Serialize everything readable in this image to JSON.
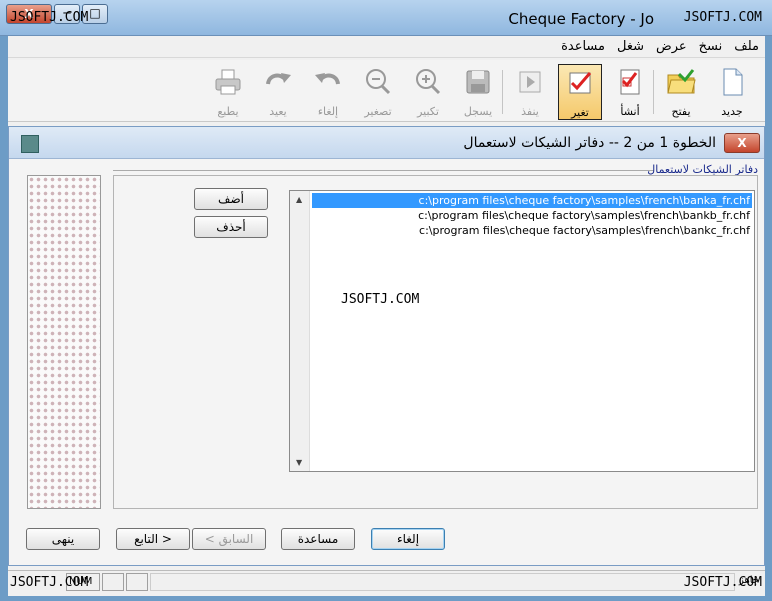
{
  "window": {
    "title": "Cheque Factory - Jo",
    "watermark": "JSOFTJ.COM",
    "close_glyph": "X",
    "min_glyph": "─",
    "max_glyph": "□"
  },
  "menu": [
    "ملف",
    "نسخ",
    "عرض",
    "شغل",
    "مساعدة"
  ],
  "toolbar": {
    "new": "جديد",
    "open": "يفتح",
    "create": "أنشأ",
    "change": "تغير",
    "execute": "ينفذ",
    "save": "يسجل",
    "zoom_in": "تكبير",
    "zoom_out": "تصغير",
    "undo": "إلغاء",
    "redo": "يعيد",
    "print": "يطبع"
  },
  "wizard": {
    "title": "الخطوة 1 من 2 -- دفاتر الشيكات لاستعمال",
    "close_glyph": "X",
    "group_caption": "دفاتر الشيكات لاستعمال",
    "add_button": "أضف",
    "remove_button": "أحذف",
    "files": [
      "c:\\program files\\cheque factory\\samples\\french\\banka_fr.chf",
      "c:\\program files\\cheque factory\\samples\\french\\bankb_fr.chf",
      "c:\\program files\\cheque factory\\samples\\french\\bankc_fr.chf"
    ],
    "selected_index": 0,
    "finish_button": "ينهى",
    "next_button": "التابع >",
    "back_button": "< السابق",
    "help_button": "مساعدة",
    "cancel_button": "إلغاء"
  },
  "status": {
    "num": "NUM",
    "right_label": "جاهز"
  }
}
